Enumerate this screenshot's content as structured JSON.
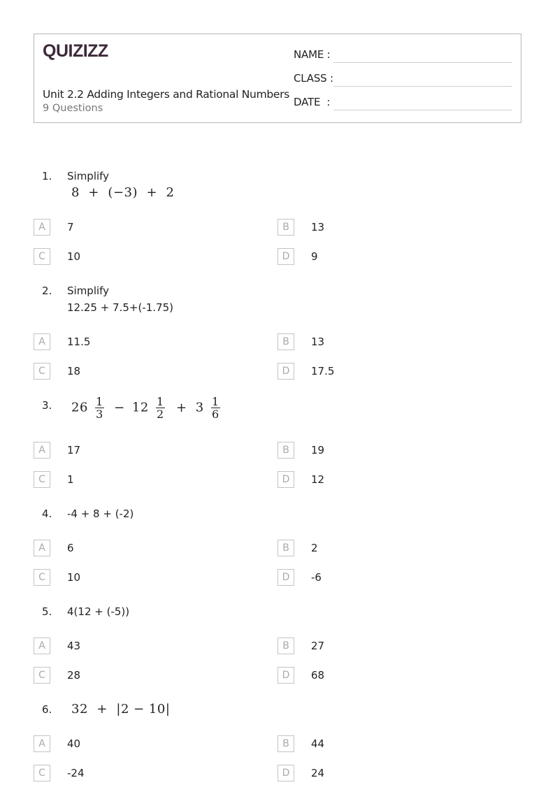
{
  "header": {
    "logo": "QUIZIZZ",
    "title": "Unit 2.2 Adding Integers and Rational Numbers",
    "subtitle": "9 Questions",
    "fields": [
      {
        "label": "NAME :"
      },
      {
        "label": "CLASS :"
      },
      {
        "label": "DATE  :"
      }
    ]
  },
  "questions": [
    {
      "number": "1.",
      "prompt": "Simplify",
      "expression": "8  +  (−3)  +  2",
      "options": [
        {
          "letter": "A",
          "value": "7"
        },
        {
          "letter": "B",
          "value": "13"
        },
        {
          "letter": "C",
          "value": "10"
        },
        {
          "letter": "D",
          "value": "9"
        }
      ]
    },
    {
      "number": "2.",
      "prompt": "Simplify",
      "expression": "12.25 + 7.5+(-1.75)",
      "options": [
        {
          "letter": "A",
          "value": "11.5"
        },
        {
          "letter": "B",
          "value": "13"
        },
        {
          "letter": "C",
          "value": "18"
        },
        {
          "letter": "D",
          "value": "17.5"
        }
      ]
    },
    {
      "number": "3.",
      "expression_parts": {
        "w1": "26",
        "n1": "1",
        "d1": "3",
        "op1": "−",
        "w2": "12",
        "n2": "1",
        "d2": "2",
        "op2": "+",
        "w3": "3",
        "n3": "1",
        "d3": "6"
      },
      "options": [
        {
          "letter": "A",
          "value": "17"
        },
        {
          "letter": "B",
          "value": "19"
        },
        {
          "letter": "C",
          "value": "1"
        },
        {
          "letter": "D",
          "value": "12"
        }
      ]
    },
    {
      "number": "4.",
      "expression": "-4 + 8 + (-2)",
      "options": [
        {
          "letter": "A",
          "value": "6"
        },
        {
          "letter": "B",
          "value": "2"
        },
        {
          "letter": "C",
          "value": "10"
        },
        {
          "letter": "D",
          "value": "-6"
        }
      ]
    },
    {
      "number": "5.",
      "expression": "4(12 + (-5))",
      "options": [
        {
          "letter": "A",
          "value": "43"
        },
        {
          "letter": "B",
          "value": "27"
        },
        {
          "letter": "C",
          "value": "28"
        },
        {
          "letter": "D",
          "value": "68"
        }
      ]
    },
    {
      "number": "6.",
      "expression": "32  +  |2 − 10|",
      "options": [
        {
          "letter": "A",
          "value": "40"
        },
        {
          "letter": "B",
          "value": "44"
        },
        {
          "letter": "C",
          "value": "-24"
        },
        {
          "letter": "D",
          "value": "24"
        }
      ]
    }
  ]
}
